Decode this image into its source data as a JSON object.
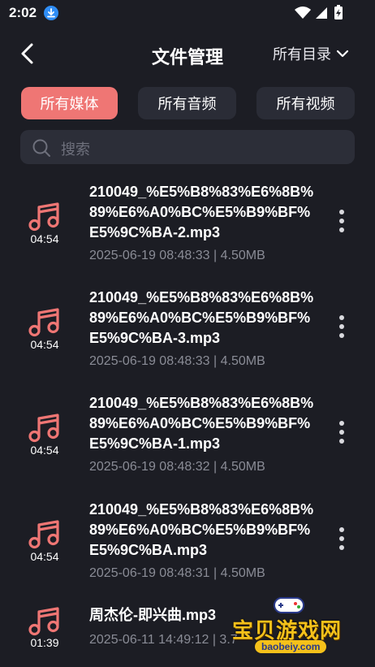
{
  "status": {
    "time": "2:02"
  },
  "header": {
    "title": "文件管理",
    "dir_label": "所有目录"
  },
  "filters": [
    {
      "label": "所有媒体",
      "active": true
    },
    {
      "label": "所有音频",
      "active": false
    },
    {
      "label": "所有视频",
      "active": false
    }
  ],
  "search": {
    "placeholder": "搜索"
  },
  "files": [
    {
      "name": "210049_%E5%B8%83%E6%8B%89%E6%A0%BC%E5%B9%BF%E5%9C%BA-2.mp3",
      "duration": "04:54",
      "meta": "2025-06-19 08:48:33 | 4.50MB"
    },
    {
      "name": "210049_%E5%B8%83%E6%8B%89%E6%A0%BC%E5%B9%BF%E5%9C%BA-3.mp3",
      "duration": "04:54",
      "meta": "2025-06-19 08:48:33 | 4.50MB"
    },
    {
      "name": "210049_%E5%B8%83%E6%8B%89%E6%A0%BC%E5%B9%BF%E5%9C%BA-1.mp3",
      "duration": "04:54",
      "meta": "2025-06-19 08:48:32 | 4.50MB"
    },
    {
      "name": "210049_%E5%B8%83%E6%8B%89%E6%A0%BC%E5%B9%BF%E5%9C%BA.mp3",
      "duration": "04:54",
      "meta": "2025-06-19 08:48:31 | 4.50MB"
    },
    {
      "name": "周杰伦-即兴曲.mp3",
      "duration": "01:39",
      "meta": "2025-06-11 14:49:12 | 3.7"
    }
  ],
  "watermark": {
    "text": "宝贝游戏网",
    "url": "baobeiy.com"
  },
  "colors": {
    "accent": "#ef7674",
    "background": "#1c1d24",
    "chip": "#2a2c36"
  }
}
